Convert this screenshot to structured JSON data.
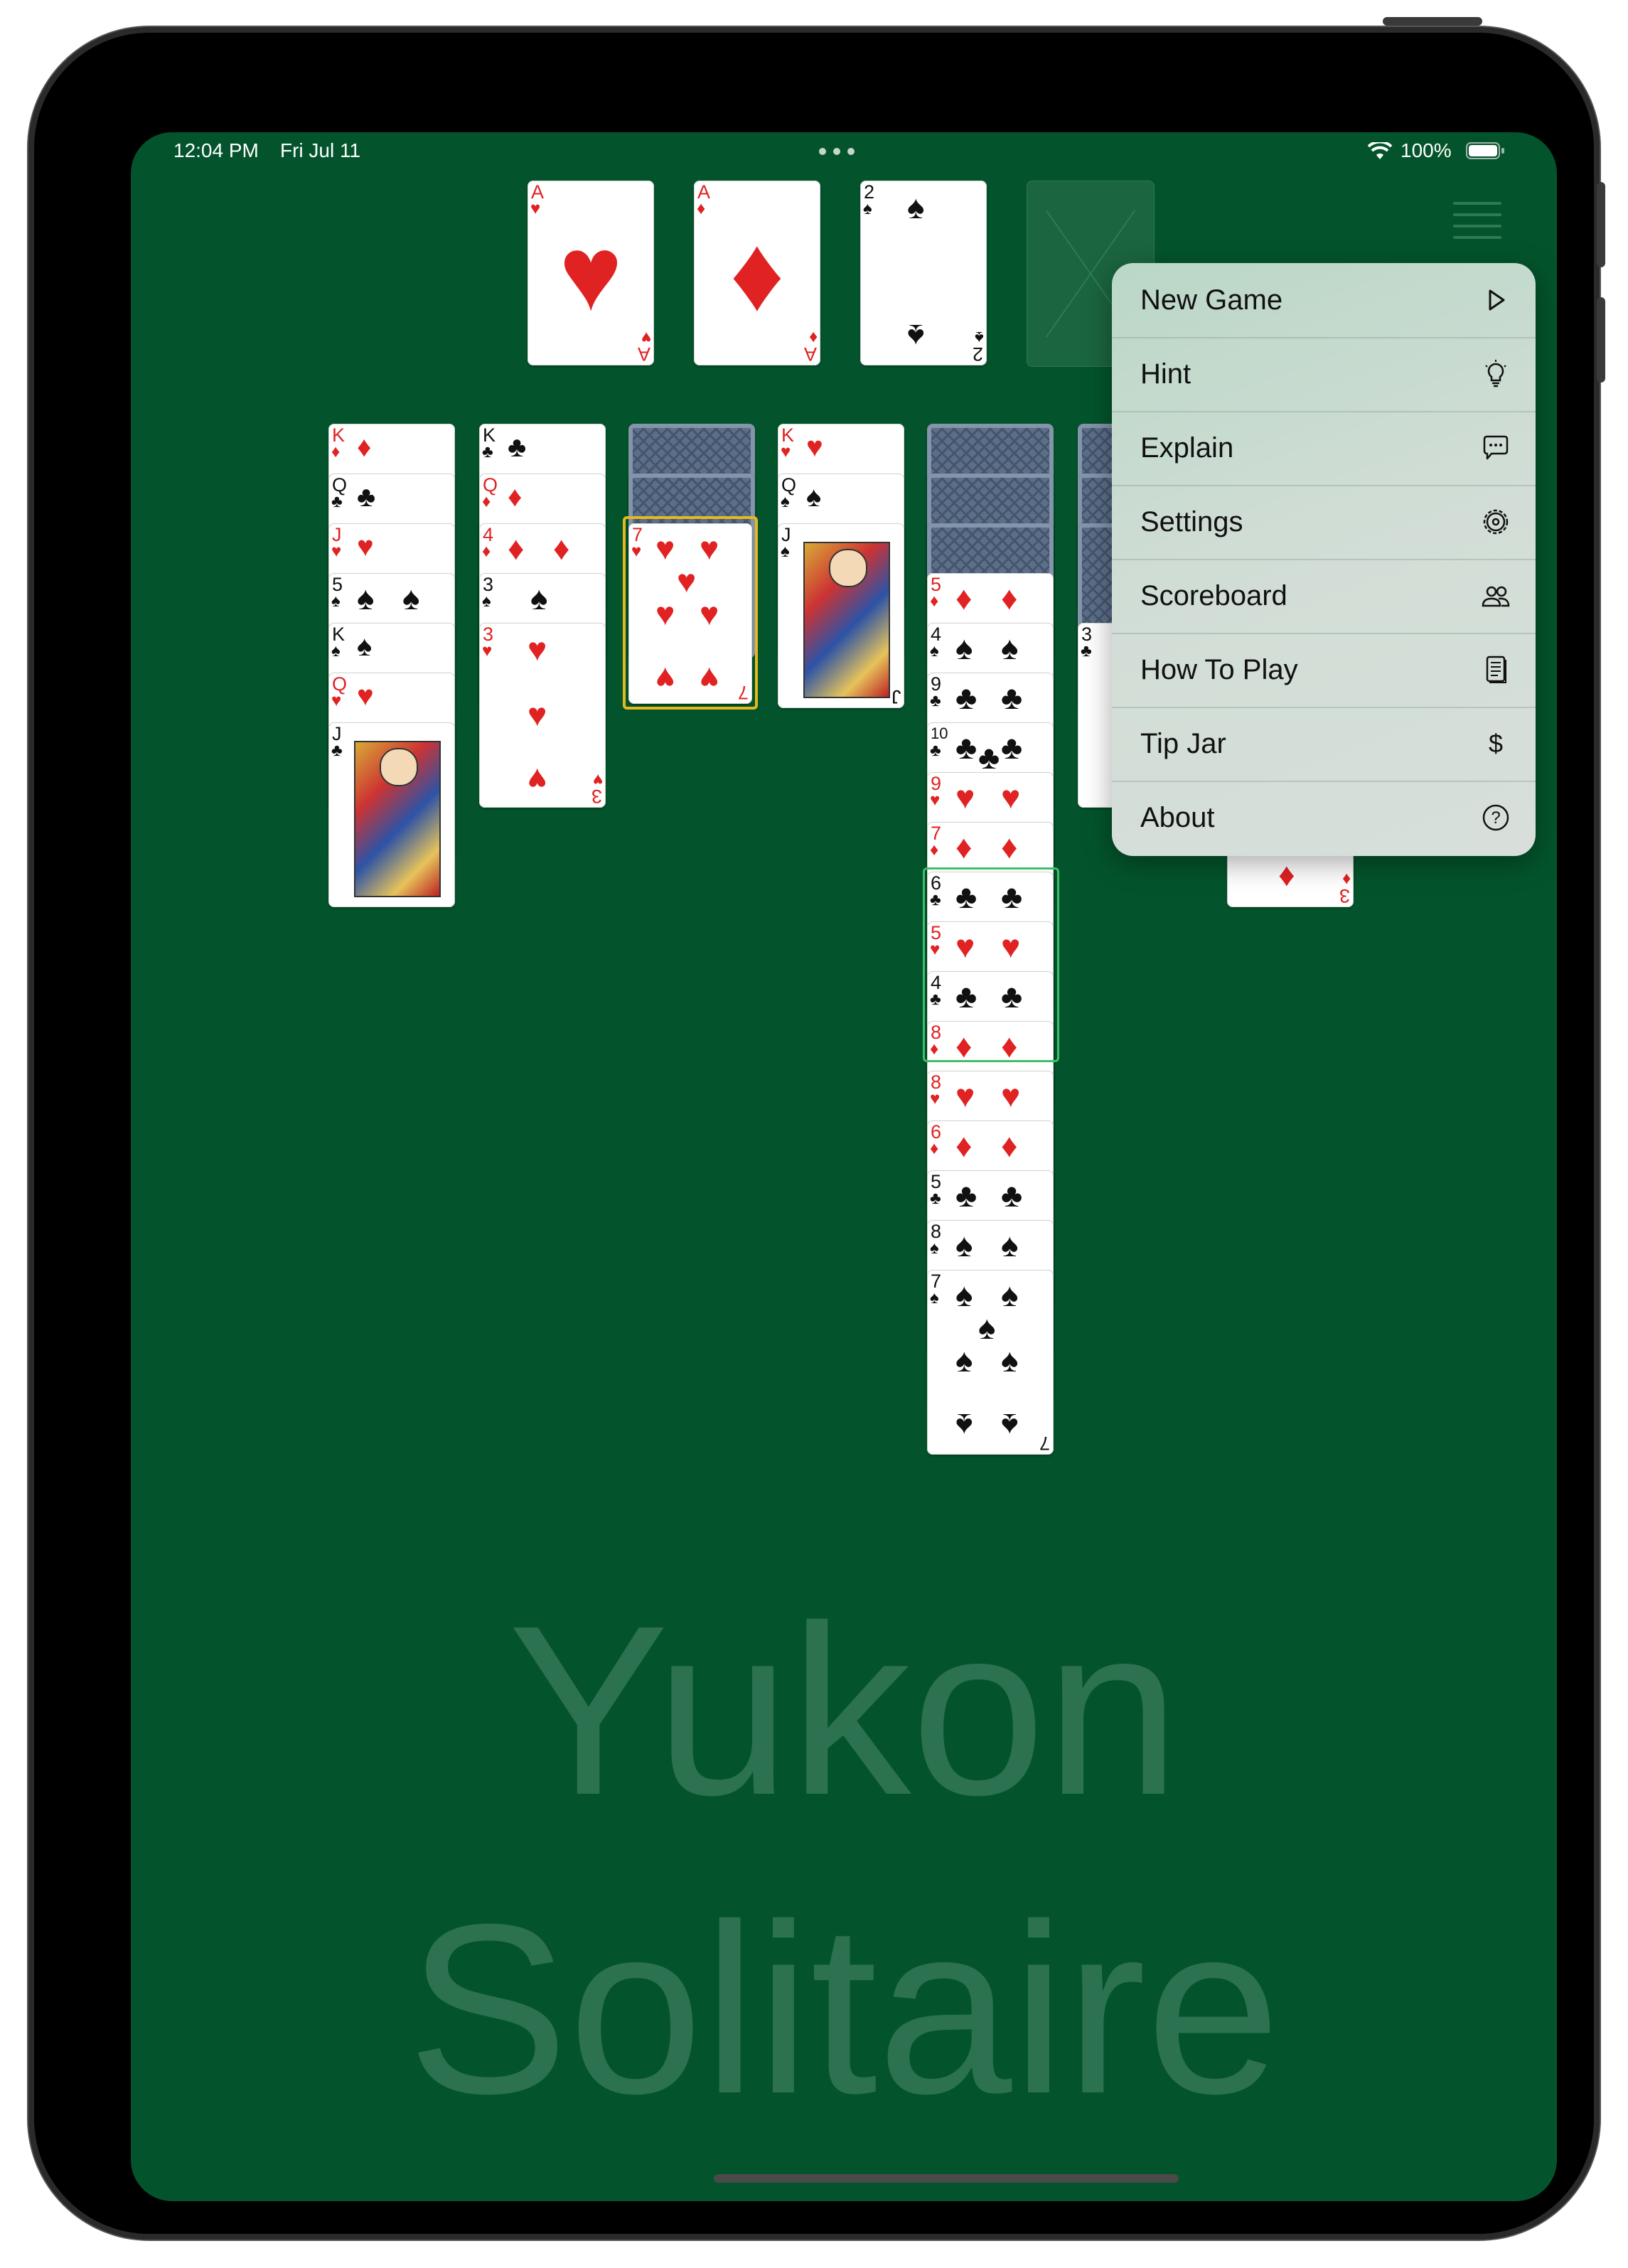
{
  "status_bar": {
    "time": "12:04 PM",
    "date": "Fri Jul 11",
    "battery": "100%"
  },
  "watermark": {
    "line1": "Yukon",
    "line2": "Solitaire"
  },
  "foundations": [
    {
      "rank": "A",
      "suit": "♥",
      "color": "red"
    },
    {
      "rank": "A",
      "suit": "♦",
      "color": "red"
    },
    {
      "rank": "2",
      "suit": "♠",
      "color": "black"
    }
  ],
  "tableau_labels": {
    "col1": [
      "K",
      "Q",
      "J",
      "5",
      "K",
      "Q",
      "J"
    ],
    "col2": [
      "K",
      "Q",
      "4",
      "3",
      "3"
    ],
    "col3": [
      "7"
    ],
    "col4": [
      "K",
      "Q",
      "J"
    ],
    "col5": [
      "5",
      "4",
      "9",
      "10",
      "9",
      "7",
      "6",
      "5",
      "4",
      "8",
      "8",
      "6",
      "5",
      "8",
      "7"
    ],
    "col6": [
      "3"
    ],
    "col7": [
      "3"
    ]
  },
  "menu": {
    "items": [
      {
        "label": "New Game",
        "icon": "play-icon"
      },
      {
        "label": "Hint",
        "icon": "lightbulb-icon"
      },
      {
        "label": "Explain",
        "icon": "speech-bubble-icon"
      },
      {
        "label": "Settings",
        "icon": "gear-icon"
      },
      {
        "label": "Scoreboard",
        "icon": "people-icon"
      },
      {
        "label": "How To Play",
        "icon": "document-icon"
      },
      {
        "label": "Tip Jar",
        "icon": "dollar-icon"
      },
      {
        "label": "About",
        "icon": "question-circle-icon"
      }
    ]
  },
  "colors": {
    "felt": "#03542c",
    "highlight_yellow": "#e6b820",
    "highlight_green": "#3fbf6a",
    "red_suit": "#e02222"
  }
}
